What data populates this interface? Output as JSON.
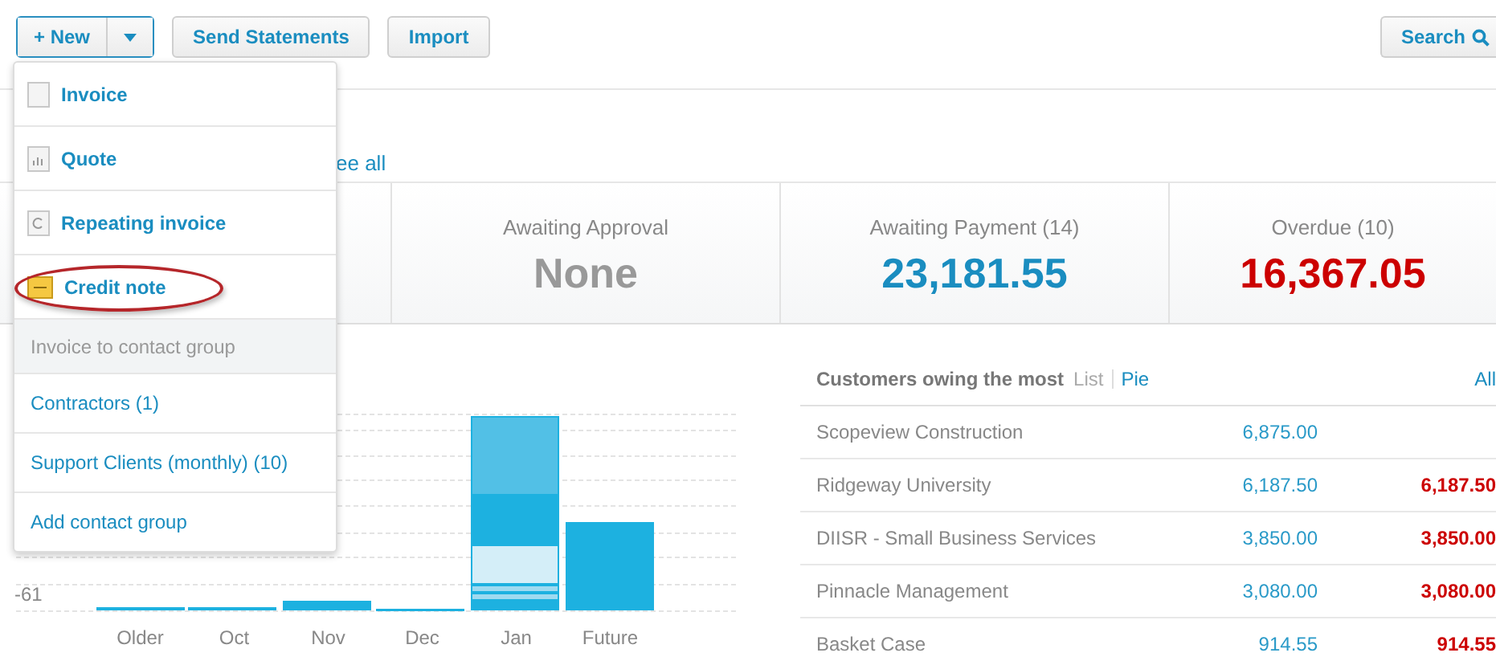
{
  "toolbar": {
    "new_button": "+ New",
    "buttons": [
      "Send Statements",
      "Import"
    ],
    "search_button": "Search"
  },
  "see_all_link": "ee all",
  "summary": [
    {
      "title": "Awaiting Approval",
      "value": "None",
      "kind": "none"
    },
    {
      "title": "Awaiting Payment (14)",
      "value": "23,181.55",
      "kind": "payment"
    },
    {
      "title": "Overdue (10)",
      "value": "16,367.05",
      "kind": "overdue"
    }
  ],
  "chart": {
    "y_label": "-61",
    "x_labels": [
      "Older",
      "Oct",
      "Nov",
      "Dec",
      "Jan",
      "Future"
    ]
  },
  "customers": {
    "title": "Customers owing the most",
    "view_options": [
      {
        "label": "List",
        "selected": true
      },
      {
        "label": "Pie",
        "selected": false
      }
    ],
    "all_link": "All",
    "rows": [
      {
        "name": "Scopeview Construction",
        "amount": "6,875.00"
      },
      {
        "name": "Ridgeway University",
        "amount": "6,187.50",
        "overdue": "6,187.50"
      },
      {
        "name": "DIISR - Small Business Services",
        "amount": "3,850.00",
        "overdue": "3,850.00"
      },
      {
        "name": "Pinnacle Management",
        "amount": "3,080.00",
        "overdue": "3,080.00"
      },
      {
        "name": "Basket Case",
        "amount": "914.55",
        "overdue": "914.55"
      }
    ]
  },
  "menu": {
    "items": [
      {
        "label": "Invoice",
        "kind": "invoice",
        "highlighted": false
      },
      {
        "label": "Quote",
        "kind": "quote",
        "highlighted": false
      },
      {
        "label": "Repeating invoice",
        "kind": "repeat",
        "highlighted": false
      },
      {
        "label": "Credit note",
        "kind": "credit",
        "highlighted": true
      }
    ],
    "group_header": "Invoice to contact group",
    "groups": [
      "Contractors (1)",
      "Support Clients (monthly) (10)"
    ],
    "add_group": "Add contact group"
  }
}
